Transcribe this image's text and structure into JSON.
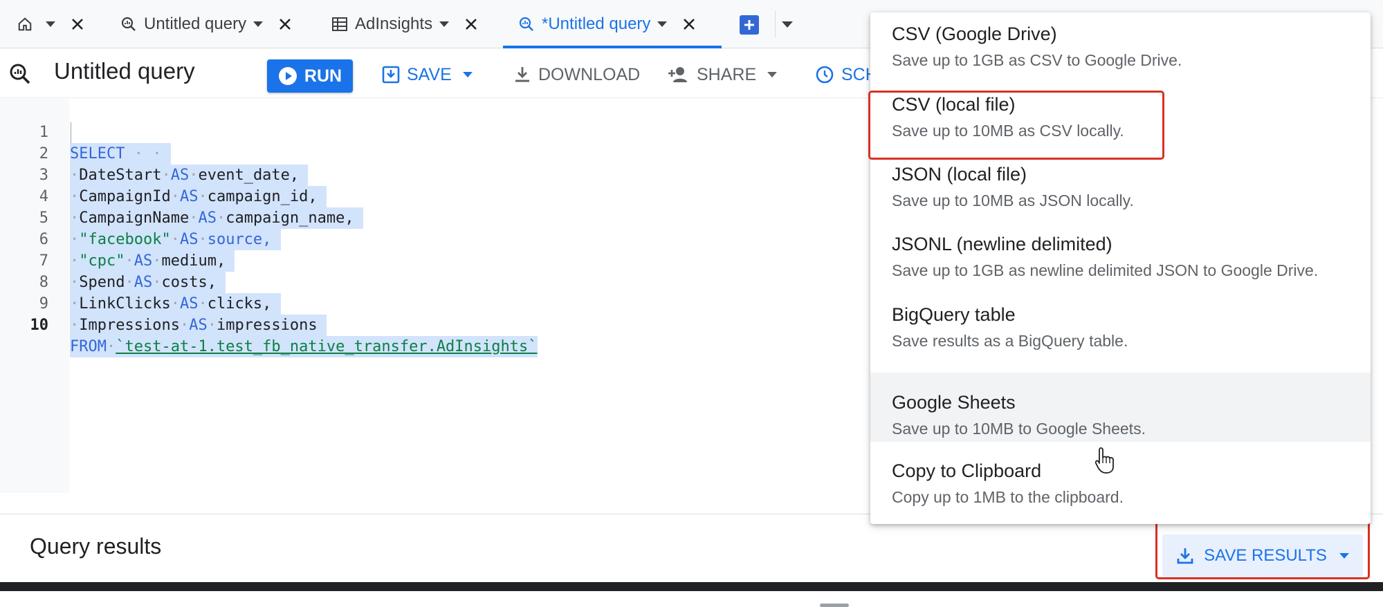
{
  "tabs": [
    {
      "label": "",
      "icon": "home-icon"
    },
    {
      "label": "Untitled query",
      "icon": "query-icon"
    },
    {
      "label": "AdInsights",
      "icon": "table-icon"
    },
    {
      "label": "*Untitled query",
      "icon": "query-icon",
      "active": true
    }
  ],
  "toolbar": {
    "title": "Untitled query",
    "run_label": "RUN",
    "save_label": "SAVE",
    "download_label": "DOWNLOAD",
    "share_label": "SHARE",
    "schedule_label": "SCH"
  },
  "editor": {
    "line_numbers": [
      "1",
      "2",
      "3",
      "4",
      "5",
      "6",
      "7",
      "8",
      "9",
      "10"
    ],
    "lines": [
      {
        "kw": "SELECT",
        "rest": ""
      },
      {
        "id": "DateStart",
        "kw": "AS",
        "alias": "event_date,"
      },
      {
        "id": "CampaignId",
        "kw": "AS",
        "alias": "campaign_id,"
      },
      {
        "id": "CampaignName",
        "kw": "AS",
        "alias": "campaign_name,"
      },
      {
        "str": "\"facebook\"",
        "kw": "AS",
        "alias": "source,"
      },
      {
        "str": "\"cpc\"",
        "kw": "AS",
        "alias": "medium,"
      },
      {
        "id": "Spend",
        "kw": "AS",
        "alias": "costs,"
      },
      {
        "id": "LinkClicks",
        "kw": "AS",
        "alias": "clicks,"
      },
      {
        "id": "Impressions",
        "kw": "AS",
        "alias": "impressions"
      },
      {
        "kw": "FROM",
        "table": "`test-at-1.test_fb_native_transfer.AdInsights`"
      }
    ]
  },
  "results": {
    "title": "Query results",
    "save_results_label": "SAVE RESULTS"
  },
  "save_menu": {
    "items": [
      {
        "title": "CSV (Google Drive)",
        "desc": "Save up to 1GB as CSV to Google Drive."
      },
      {
        "title": "CSV (local file)",
        "desc": "Save up to 10MB as CSV locally."
      },
      {
        "title": "JSON (local file)",
        "desc": "Save up to 10MB as JSON locally."
      },
      {
        "title": "JSONL (newline delimited)",
        "desc": "Save up to 1GB as newline delimited JSON to Google Drive."
      },
      {
        "title": "BigQuery table",
        "desc": "Save results as a BigQuery table."
      },
      {
        "title": "Google Sheets",
        "desc": "Save up to 10MB to Google Sheets."
      },
      {
        "title": "Copy to Clipboard",
        "desc": "Copy up to 1MB to the clipboard."
      }
    ]
  },
  "colors": {
    "accent": "#1a73e8",
    "highlight_box": "#d93025",
    "selection": "#d2e3fc"
  }
}
